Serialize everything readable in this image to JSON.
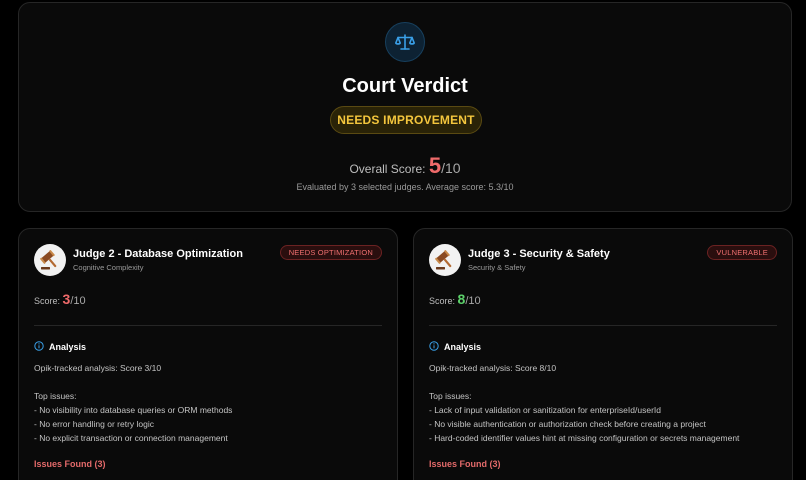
{
  "verdict": {
    "icon": "scales-icon",
    "title": "Court Verdict",
    "badge": "NEEDS IMPROVEMENT",
    "overall_label": "Overall Score:",
    "overall_score": "5",
    "overall_denominator": "/10",
    "evaluated_text": "Evaluated by 3 selected judges. Average score: 5.3/10",
    "colors": {
      "badge": "#f4c63d",
      "score": "#ef6a6a",
      "icon": "#3aa0e8"
    }
  },
  "judges": [
    {
      "avatar": "gavel-icon",
      "name": "Judge 2 - Database Optimization",
      "subtitle": "Cognitive Complexity",
      "status": "NEEDS OPTIMIZATION",
      "score_label": "Score:",
      "score": "3",
      "score_denominator": "/10",
      "score_color": "#ef6a6a",
      "analysis_title": "Analysis",
      "analysis_text": "Opik-tracked analysis: Score 3/10\n\nTop issues:\n- No visibility into database queries or ORM methods\n- No error handling or retry logic\n- No explicit transaction or connection management",
      "issues_found": "Issues Found (3)"
    },
    {
      "avatar": "gavel-icon",
      "name": "Judge 3 - Security & Safety",
      "subtitle": "Security & Safety",
      "status": "VULNERABLE",
      "score_label": "Score:",
      "score": "8",
      "score_denominator": "/10",
      "score_color": "#5cd16a",
      "analysis_title": "Analysis",
      "analysis_text": "Opik-tracked analysis: Score 8/10\n\nTop issues:\n- Lack of input validation or sanitization for enterpriseId/userId\n- No visible authentication or authorization check before creating a project\n- Hard-coded identifier values hint at missing configuration or secrets management",
      "issues_found": "Issues Found (3)"
    }
  ]
}
